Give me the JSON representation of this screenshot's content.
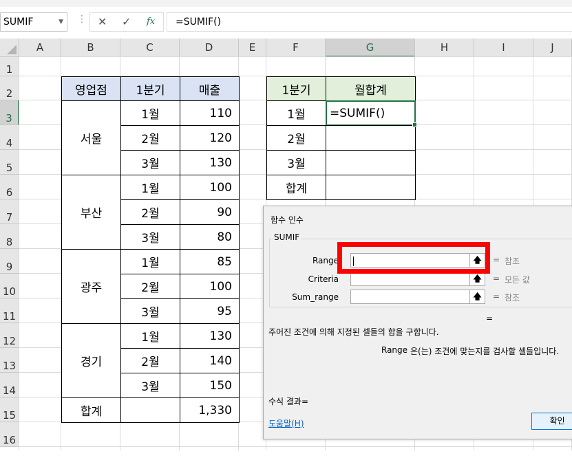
{
  "formula_bar": {
    "name_box": "SUMIF",
    "formula": "=SUMIF()",
    "cancel_icon": "✕",
    "enter_icon": "✓",
    "fx_icon": "fx"
  },
  "columns": [
    "A",
    "B",
    "C",
    "D",
    "E",
    "F",
    "G",
    "H",
    "I",
    "J"
  ],
  "rows": [
    "1",
    "2",
    "3",
    "4",
    "5",
    "6",
    "7",
    "8",
    "9",
    "10",
    "11",
    "12",
    "13",
    "14",
    "15",
    "16"
  ],
  "table1": {
    "headers": [
      "영업점",
      "1분기",
      "매출"
    ],
    "groups": [
      "서울",
      "부산",
      "광주",
      "경기"
    ],
    "months": [
      "1월",
      "2월",
      "3월",
      "1월",
      "2월",
      "3월",
      "1월",
      "2월",
      "3월",
      "1월",
      "2월",
      "3월"
    ],
    "sales": [
      "110",
      "120",
      "130",
      "100",
      "90",
      "80",
      "85",
      "100",
      "95",
      "130",
      "140",
      "150"
    ],
    "total_label": "합계",
    "total_value": "1,330"
  },
  "table2": {
    "headers": [
      "1분기",
      "월합계"
    ],
    "rows": [
      "1월",
      "2월",
      "3월",
      "합계"
    ],
    "active_value": "=SUMIF()"
  },
  "dialog": {
    "title": "함수 인수",
    "group_name": "SUMIF",
    "args": [
      {
        "label": "Range",
        "hint": "참조"
      },
      {
        "label": "Criteria",
        "hint": "모든 값"
      },
      {
        "label": "Sum_range",
        "hint": "참조"
      }
    ],
    "equals": "=",
    "result_equals": "=",
    "description": "주어진 조건에 의해 지정된 셀들의 합을 구합니다.",
    "arg_name": "Range",
    "arg_description": "은(는) 조건에 맞는지를 검사할 셀들입니다.",
    "result_label": "수식 결과=",
    "help_link": "도움말(H)",
    "ok_label": "확인"
  }
}
